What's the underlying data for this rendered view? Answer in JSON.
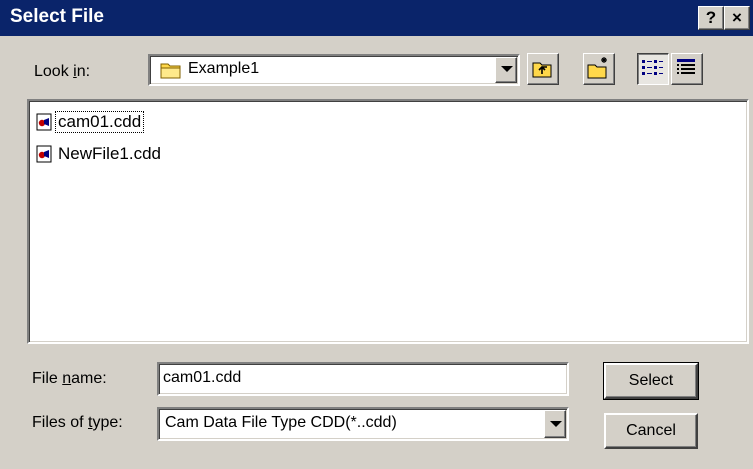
{
  "window": {
    "title": "Select File",
    "help_button": "?",
    "close_button": "×"
  },
  "look_in": {
    "label_pre": "Look ",
    "label_ul": "i",
    "label_post": "n:",
    "value": "Example1",
    "value_icon": "folder-icon"
  },
  "toolbar": {
    "up_folder_icon": "up-one-level-icon",
    "new_folder_icon": "new-folder-icon",
    "list_view_icon": "list-view-icon",
    "details_view_icon": "details-view-icon",
    "active_view": "list"
  },
  "files": [
    {
      "name": "cam01.cdd",
      "icon": "cdd-file-icon",
      "focused": true
    },
    {
      "name": "NewFile1.cdd",
      "icon": "cdd-file-icon",
      "focused": false
    }
  ],
  "file_name": {
    "label_pre": "File ",
    "label_ul": "n",
    "label_post": "ame:",
    "value": "cam01.cdd"
  },
  "file_type": {
    "label_pre": "Files of ",
    "label_ul": "t",
    "label_post": "ype:",
    "value": "Cam Data File Type CDD(*..cdd)"
  },
  "buttons": {
    "select": "Select",
    "cancel": "Cancel"
  }
}
